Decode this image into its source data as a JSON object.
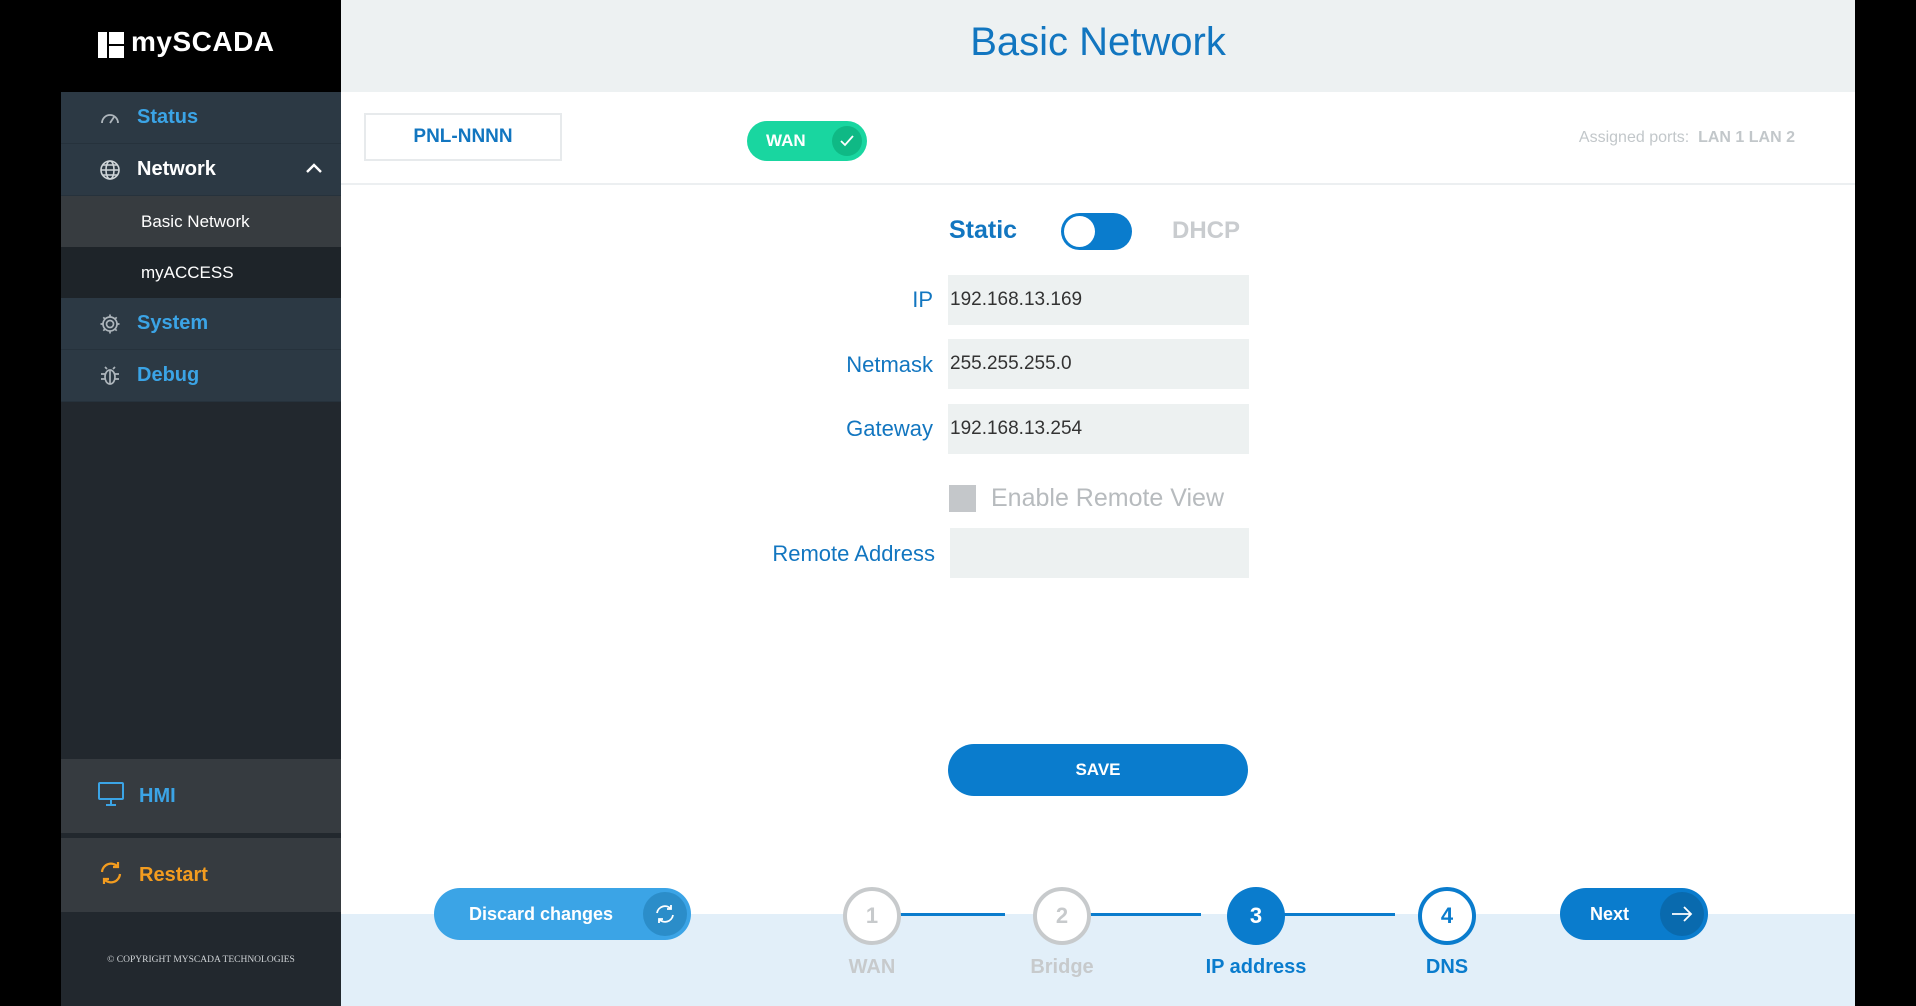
{
  "brand": {
    "name": "mySCADA"
  },
  "sidebar": {
    "items": [
      {
        "label": "Status",
        "icon": "gauge-icon"
      },
      {
        "label": "Network",
        "icon": "globe-icon",
        "expanded": true
      },
      {
        "label": "System",
        "icon": "gear-icon"
      },
      {
        "label": "Debug",
        "icon": "bug-icon"
      }
    ],
    "network_sub": [
      {
        "label": "Basic Network",
        "active": true
      },
      {
        "label": "myACCESS",
        "active": false
      }
    ],
    "hmi": {
      "label": "HMI",
      "icon": "monitor-icon"
    },
    "restart": {
      "label": "Restart",
      "icon": "refresh-icon"
    },
    "copyright": "© COPYRIGHT MYSCADA TECHNOLOGIES"
  },
  "page": {
    "title": "Basic Network"
  },
  "toolbar": {
    "device": "PNL-NNNN",
    "wan_label": "WAN",
    "ports_label": "Assigned ports:",
    "ports_value": "LAN 1 LAN 2"
  },
  "form": {
    "mode_static": "Static",
    "mode_dhcp": "DHCP",
    "ip_label": "IP",
    "ip_value": "192.168.13.169",
    "netmask_label": "Netmask",
    "netmask_value": "255.255.255.0",
    "gateway_label": "Gateway",
    "gateway_value": "192.168.13.254",
    "remote_view_label": "Enable Remote View",
    "remote_address_label": "Remote Address",
    "remote_address_value": "",
    "save_label": "SAVE"
  },
  "wizard": {
    "discard_label": "Discard changes",
    "next_label": "Next",
    "steps": [
      {
        "num": "1",
        "label": "WAN"
      },
      {
        "num": "2",
        "label": "Bridge"
      },
      {
        "num": "3",
        "label": "IP address"
      },
      {
        "num": "4",
        "label": "DNS"
      }
    ]
  },
  "colors": {
    "accent": "#0a7ccd",
    "wan_green": "#19d6a0",
    "restart_orange": "#f39c1f",
    "sidebar_bg": "#22282e"
  }
}
